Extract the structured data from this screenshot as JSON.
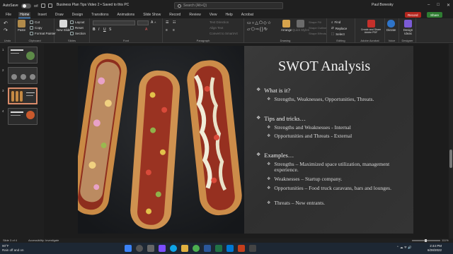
{
  "titlebar": {
    "autosave_label": "AutoSave",
    "autosave_state": "Off",
    "doc_title": "Business Plan Tips Video 2 • Saved to this PC",
    "search_placeholder": "Search (Alt+Q)",
    "user": "Paul Bonesky"
  },
  "tabs": [
    "File",
    "Home",
    "Insert",
    "Draw",
    "Design",
    "Transitions",
    "Animations",
    "Slide Show",
    "Record",
    "Review",
    "View",
    "Help",
    "Acrobat"
  ],
  "active_tab": "Home",
  "record_label": "Record",
  "share_label": "Share",
  "ribbon": {
    "groups": {
      "undo": "Undo",
      "clipboard": "Clipboard",
      "slides": "Slides",
      "font": "Font",
      "paragraph": "Paragraph",
      "drawing": "Drawing",
      "editing": "Editing",
      "adobe": "Adobe Acrobat",
      "voice": "Voice",
      "designer": "Designer"
    },
    "paste": "Paste",
    "cut": "Cut",
    "copy": "Copy",
    "format_painter": "Format Painter",
    "new_slide": "New Slide",
    "layout": "Layout",
    "reset": "Reset",
    "section": "Section",
    "text_direction": "Text Direction",
    "align_text": "Align Text",
    "convert_smartart": "Convert to SmartArt",
    "arrange": "Arrange",
    "quick_styles": "Quick Styles",
    "shape_fill": "Shape Fill",
    "shape_outline": "Shape Outline",
    "shape_effects": "Shape Effects",
    "find": "Find",
    "replace": "Replace",
    "select": "Select",
    "create_share": "Create and Share Adobe PDF",
    "dictate": "Dictate",
    "design_ideas": "Design Ideas"
  },
  "thumbnails": [
    {
      "num": "1"
    },
    {
      "num": "2"
    },
    {
      "num": "3"
    },
    {
      "num": "4"
    }
  ],
  "slide": {
    "title": "SWOT Analysis",
    "sections": [
      {
        "heading": "What is it?",
        "items": [
          "Strengths, Weaknesses, Opportunities, Threats."
        ]
      },
      {
        "heading": "Tips and tricks…",
        "items": [
          "Strengths and Weaknesses - Internal",
          "Opportunities and Threats - External"
        ]
      },
      {
        "heading": "Examples…",
        "items": [
          "Strengths – Maximized space utilization, management experience.",
          "Weaknesses – Startup company.",
          "Opportunities – Food truck caravans, bars and lounges.",
          "Threats – New entrants."
        ]
      }
    ]
  },
  "status": {
    "slide_count": "Slide 3 of 4",
    "accessibility": "Accessibility: Investigate",
    "zoom": "111%"
  },
  "taskbar": {
    "weather_temp": "90°F",
    "weather_desc": "Rain off and on",
    "time": "2:44 PM",
    "date": "6/28/2022"
  },
  "colors": {
    "accent_record": "#b3261e",
    "accent_share": "#2f7d32",
    "thumb_selected": "#d98b6a"
  }
}
